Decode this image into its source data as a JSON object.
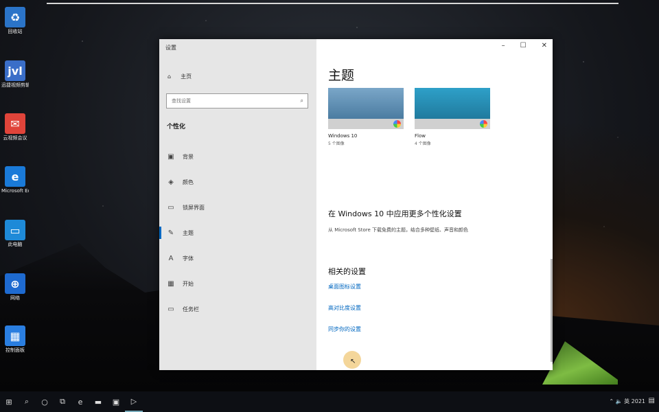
{
  "desktop": {
    "icons": [
      {
        "label": "回收站",
        "glyph": "♻",
        "color": "#2b74c8"
      },
      {
        "label": "迅捷视频剪辑",
        "glyph": "jvl",
        "color": "#3a6ec8"
      },
      {
        "label": "云视频会议",
        "glyph": "✉",
        "color": "#e0443a"
      },
      {
        "label": "Microsoft Edge",
        "glyph": "e",
        "color": "#1a7ad8"
      },
      {
        "label": "此电脑",
        "glyph": "▭",
        "color": "#1e8ad8"
      },
      {
        "label": "网络",
        "glyph": "⊕",
        "color": "#1e6ad0"
      },
      {
        "label": "控制面板",
        "glyph": "▦",
        "color": "#2a7ee0"
      }
    ]
  },
  "window": {
    "title": "设置",
    "controls": [
      "–",
      "☐",
      "✕"
    ],
    "sidebar": {
      "home_label": "主页",
      "home_icon": "home-icon",
      "search_placeholder": "查找设置",
      "section_title": "个性化",
      "items": [
        {
          "label": "背景",
          "icon": "image-icon",
          "glyph": "▣",
          "active": false
        },
        {
          "label": "颜色",
          "icon": "palette-icon",
          "glyph": "◈",
          "active": false
        },
        {
          "label": "锁屏界面",
          "icon": "lock-screen-icon",
          "glyph": "▭",
          "active": false
        },
        {
          "label": "主题",
          "icon": "brush-icon",
          "glyph": "✎",
          "active": true
        },
        {
          "label": "字体",
          "icon": "font-icon",
          "glyph": "A",
          "active": false
        },
        {
          "label": "开始",
          "icon": "start-icon",
          "glyph": "▦",
          "active": false
        },
        {
          "label": "任务栏",
          "icon": "taskbar-icon",
          "glyph": "▭",
          "active": false
        }
      ]
    },
    "main": {
      "heading": "主题",
      "themes": [
        {
          "name": "Windows 10",
          "count": "5 个图像",
          "colors": [
            "#7aa6c8",
            "#3b6e94"
          ]
        },
        {
          "name": "Flow",
          "count": "4 个图像",
          "colors": [
            "#2ea0c8",
            "#1c6e90"
          ]
        }
      ],
      "store_heading": "在 Windows 10 中应用更多个性化设置",
      "store_text": "从 Microsoft Store 下载免费的主题，结合多种壁纸、声音和颜色",
      "related_heading": "相关的设置",
      "related_links": [
        "桌面图标设置",
        "高对比度设置",
        "同步你的设置"
      ]
    }
  },
  "taskbar": {
    "items": [
      {
        "icon": "windows-start-icon",
        "glyph": "⊞"
      },
      {
        "icon": "search-icon",
        "glyph": "⌕"
      },
      {
        "icon": "cortana-icon",
        "glyph": "○"
      },
      {
        "icon": "task-view-icon",
        "glyph": "⧉"
      },
      {
        "icon": "edge-icon",
        "glyph": "e"
      },
      {
        "icon": "file-explorer-icon",
        "glyph": "▬"
      },
      {
        "icon": "store-icon",
        "glyph": "▣"
      },
      {
        "icon": "settings-app-icon",
        "glyph": "▷",
        "active": true
      }
    ],
    "tray_text": "⌃ 🔈 英 2021",
    "notification_icon": "▤"
  }
}
